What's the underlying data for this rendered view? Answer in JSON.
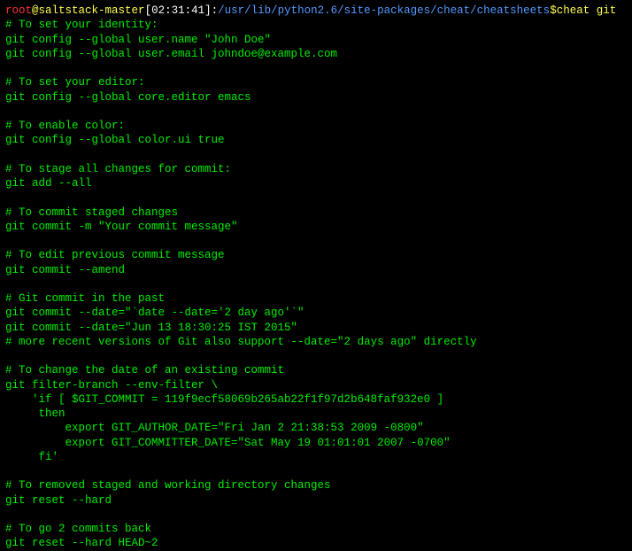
{
  "prompt": {
    "user": "root",
    "at": "@",
    "host": "saltstack-master",
    "lbracket": "[",
    "time": "02:31:41",
    "rbracket": "]",
    "colon": ":",
    "path": "/usr/lib/python2.6/site-packages/cheat/cheatsheets",
    "dollar": "$",
    "command": "cheat git"
  },
  "lines": [
    "# To set your identity:",
    "git config --global user.name \"John Doe\"",
    "git config --global user.email johndoe@example.com",
    "",
    "# To set your editor:",
    "git config --global core.editor emacs",
    "",
    "# To enable color:",
    "git config --global color.ui true",
    "",
    "# To stage all changes for commit:",
    "git add --all",
    "",
    "# To commit staged changes",
    "git commit -m \"Your commit message\"",
    "",
    "# To edit previous commit message",
    "git commit --amend",
    "",
    "# Git commit in the past",
    "git commit --date=\"`date --date='2 day ago'`\"",
    "git commit --date=\"Jun 13 18:30:25 IST 2015\"",
    "# more recent versions of Git also support --date=\"2 days ago\" directly",
    "",
    "# To change the date of an existing commit",
    "git filter-branch --env-filter \\",
    "    'if [ $GIT_COMMIT = 119f9ecf58069b265ab22f1f97d2b648faf932e0 ]",
    "     then",
    "         export GIT_AUTHOR_DATE=\"Fri Jan 2 21:38:53 2009 -0800\"",
    "         export GIT_COMMITTER_DATE=\"Sat May 19 01:01:01 2007 -0700\"",
    "     fi'",
    "",
    "# To removed staged and working directory changes",
    "git reset --hard",
    "",
    "# To go 2 commits back",
    "git reset --hard HEAD~2"
  ]
}
